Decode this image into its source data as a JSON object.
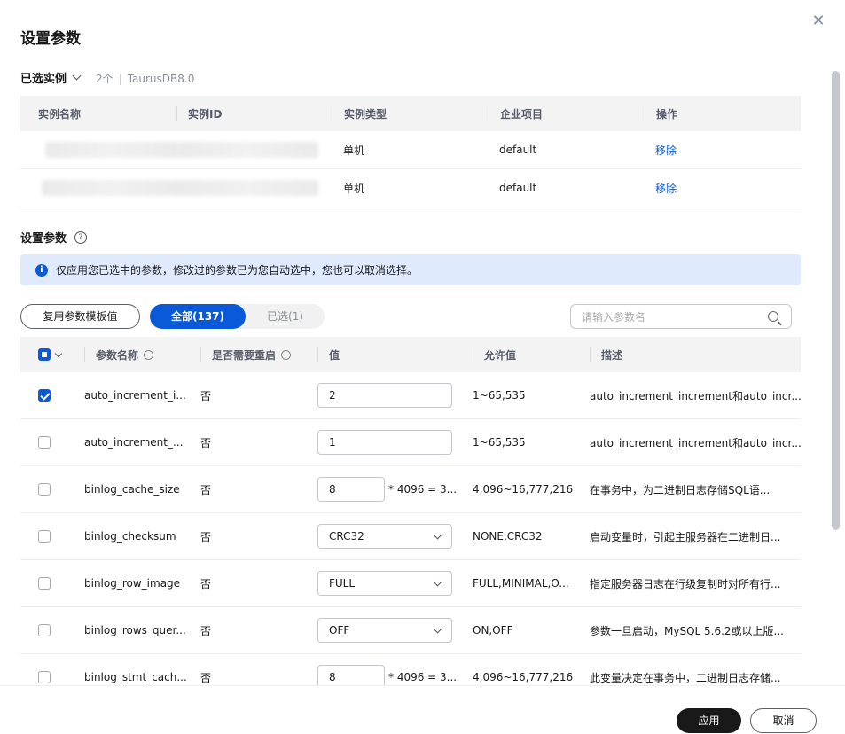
{
  "dialog": {
    "title": "设置参数",
    "close_icon": "close-icon"
  },
  "selected_instances": {
    "heading": "已选实例",
    "count": "2个",
    "engine": "TaurusDB8.0",
    "columns": [
      "实例名称",
      "实例ID",
      "实例类型",
      "企业项目",
      "操作"
    ],
    "rows": [
      {
        "name": "",
        "id": "",
        "type": "单机",
        "project": "default",
        "action": "移除"
      },
      {
        "name": "",
        "id": "",
        "type": "单机",
        "project": "default",
        "action": "移除"
      }
    ]
  },
  "params_section": {
    "heading": "设置参数",
    "help_icon": "question-circle-icon",
    "info_text": "仅应用您已选中的参数，修改过的参数已为您自动选中，您也可以取消选择。",
    "template_button": "复用参数模板值",
    "tabs": [
      {
        "label": "全部(137)",
        "active": true
      },
      {
        "label": "已选(1)",
        "active": false
      }
    ],
    "search_placeholder": "请输入参数名"
  },
  "param_table": {
    "columns": [
      "参数名称",
      "是否需要重启",
      "值",
      "允许值",
      "描述"
    ],
    "rows": [
      {
        "checked": true,
        "name": "auto_increment_i...",
        "restart": "否",
        "kind": "input",
        "value": "2",
        "suffix": "",
        "allowed": "1~65,535",
        "desc": "auto_increment_increment和auto_incr..."
      },
      {
        "checked": false,
        "name": "auto_increment_...",
        "restart": "否",
        "kind": "input",
        "value": "1",
        "suffix": "",
        "allowed": "1~65,535",
        "desc": "auto_increment_increment和auto_incr..."
      },
      {
        "checked": false,
        "name": "binlog_cache_size",
        "restart": "否",
        "kind": "input-narrow",
        "value": "8",
        "suffix": "* 4096 = 3...",
        "allowed": "4,096~16,777,216",
        "desc": "在事务中，为二进制日志存储SQL语..."
      },
      {
        "checked": false,
        "name": "binlog_checksum",
        "restart": "否",
        "kind": "select",
        "value": "CRC32",
        "suffix": "",
        "allowed": "NONE,CRC32",
        "desc": "启动变量时，引起主服务器在二进制日..."
      },
      {
        "checked": false,
        "name": "binlog_row_image",
        "restart": "否",
        "kind": "select",
        "value": "FULL",
        "suffix": "",
        "allowed": "FULL,MINIMAL,O...",
        "desc": "指定服务器日志在行级复制时对所有行..."
      },
      {
        "checked": false,
        "name": "binlog_rows_quer...",
        "restart": "否",
        "kind": "select",
        "value": "OFF",
        "suffix": "",
        "allowed": "ON,OFF",
        "desc": "参数一旦启动，MySQL 5.6.2或以上版..."
      },
      {
        "checked": false,
        "name": "binlog_stmt_cach...",
        "restart": "否",
        "kind": "input-narrow",
        "value": "8",
        "suffix": "* 4096 = 3...",
        "allowed": "4,096~16,777,216",
        "desc": "此变量决定在事务中，二进制日志存储..."
      }
    ]
  },
  "footer": {
    "apply": "应用",
    "cancel": "取消"
  },
  "colors": {
    "primary": "#0a59d9",
    "info_bg": "#dfeafd",
    "apply_bg": "#191919"
  }
}
